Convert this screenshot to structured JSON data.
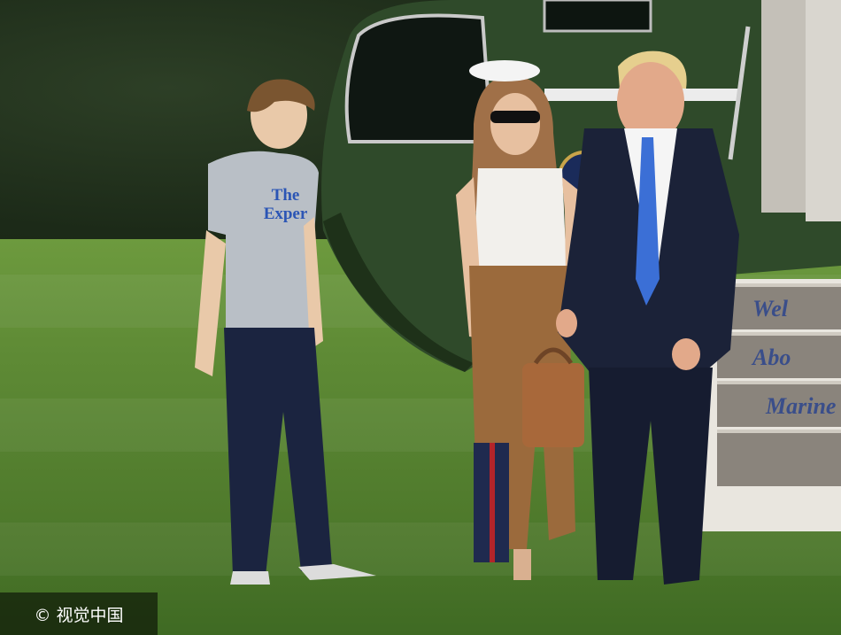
{
  "scene": {
    "description_label": "photo",
    "shirt_text": [
      "The",
      "Exper"
    ],
    "stair_text": [
      "Wel",
      "Abo",
      "Marine"
    ],
    "watermark": "© 视觉中国"
  },
  "colors": {
    "lawn": "#5e8a35",
    "helicopter_green": "#2f4a2a",
    "stair_lettering": "#3a4e8a",
    "shirt_lettering": "#2b55b5",
    "tie": "#3b6fd6",
    "suit": "#1b2238"
  }
}
